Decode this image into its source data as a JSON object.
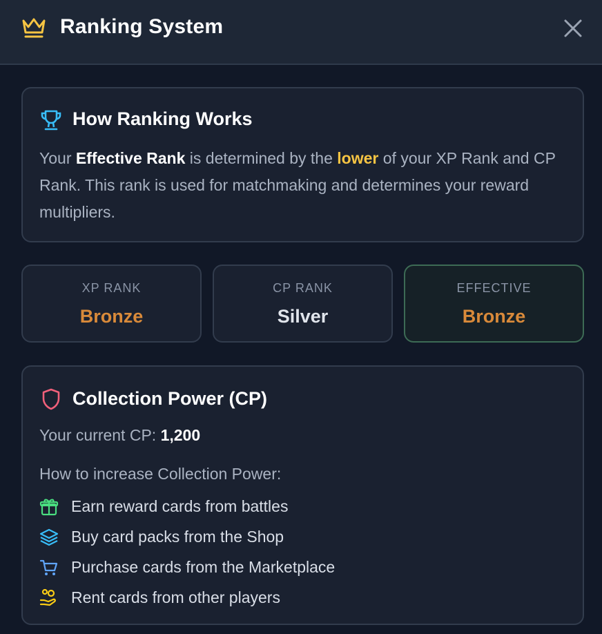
{
  "header": {
    "title": "Ranking System",
    "icon": "crown-icon",
    "close_icon": "close-icon",
    "accent": "#f6c443"
  },
  "how": {
    "title": "How Ranking Works",
    "icon": "trophy-icon",
    "desc_part1": "Your ",
    "desc_bold": "Effective Rank",
    "desc_part2": " is determined by the ",
    "desc_highlight": "lower",
    "desc_part3": " of your XP Rank and CP Rank. This rank is used for matchmaking and determines your reward multipliers."
  },
  "ranks": [
    {
      "label": "XP RANK",
      "value": "Bronze",
      "color": "#d98a3a"
    },
    {
      "label": "CP RANK",
      "value": "Silver",
      "color": "#e1e5ec"
    },
    {
      "label": "EFFECTIVE",
      "value": "Bronze",
      "color": "#d98a3a"
    }
  ],
  "cp": {
    "title": "Collection Power (CP)",
    "icon": "shield-icon",
    "current_label": "Your current CP: ",
    "current_value": "1,200",
    "howto": "How to increase Collection Power:",
    "tips": [
      {
        "icon": "gift-icon",
        "text": "Earn reward cards from battles",
        "color": "#4ade80"
      },
      {
        "icon": "layers-icon",
        "text": "Buy card packs from the Shop",
        "color": "#38bdf8"
      },
      {
        "icon": "cart-icon",
        "text": "Purchase cards from the Marketplace",
        "color": "#60a5fa"
      },
      {
        "icon": "hand-coins-icon",
        "text": "Rent cards from other players",
        "color": "#facc15"
      }
    ]
  }
}
